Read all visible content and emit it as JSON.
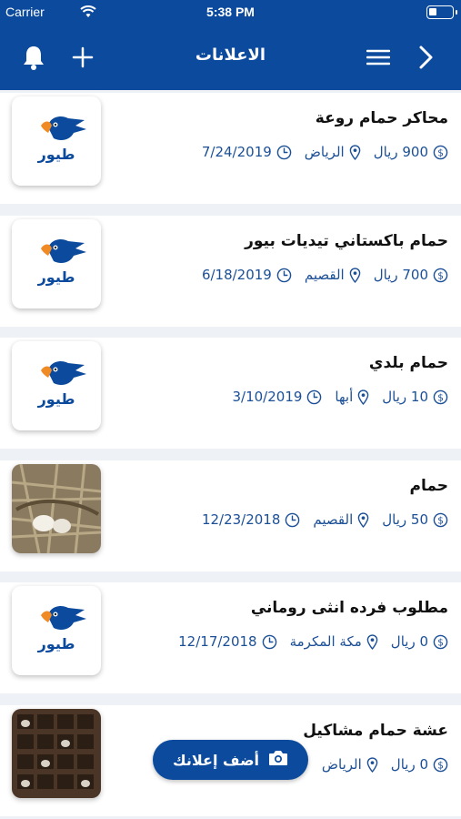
{
  "status_bar": {
    "carrier": "Carrier",
    "time": "5:38 PM"
  },
  "header": {
    "title": "الاعلانات",
    "icons": [
      "bell-icon",
      "plus-icon",
      "menu-icon",
      "chevron-right-icon"
    ]
  },
  "ads": [
    {
      "title": "محاكر حمام روعة",
      "price": "900 ريال",
      "location": "الرياض",
      "date": "7/24/2019",
      "image": "logo",
      "logo_text": "طيور"
    },
    {
      "title": "حمام باكستاني تيديات بيور",
      "price": "700 ريال",
      "location": "القصيم",
      "date": "6/18/2019",
      "image": "logo",
      "logo_text": "طيور"
    },
    {
      "title": "حمام بلدي",
      "price": "10 ريال",
      "location": "أبها",
      "date": "3/10/2019",
      "image": "logo",
      "logo_text": "طيور"
    },
    {
      "title": "حمام",
      "price": "50 ريال",
      "location": "القصيم",
      "date": "12/23/2018",
      "image": "nest-photo"
    },
    {
      "title": "مطلوب فرده انثى روماني",
      "price": "0 ريال",
      "location": "مكة المكرمة",
      "date": "12/17/2018",
      "image": "logo",
      "logo_text": "طيور"
    },
    {
      "title": "عشة حمام مشاكيل",
      "price": "0 ريال",
      "location": "الرياض",
      "date": "",
      "image": "loft-photo"
    }
  ],
  "fab": {
    "label": "أضف إعلانك",
    "icon": "camera-icon"
  },
  "colors": {
    "primary": "#0b4a9c",
    "meta_text": "#1b4f96",
    "background": "#eef2f7",
    "logo_orange": "#f08a24"
  }
}
